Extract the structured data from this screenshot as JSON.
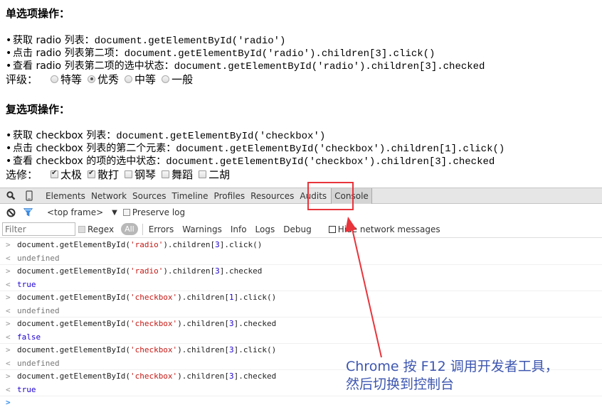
{
  "page": {
    "radio_section": {
      "title": "单选项操作：",
      "bullets": [
        {
          "label": "获取 radio 列表：",
          "code": "document.getElementById('radio')"
        },
        {
          "label": "点击 radio 列表第二项：",
          "code": "document.getElementById('radio').children[3].click()"
        },
        {
          "label": "查看 radio 列表第二项的选中状态：",
          "code": "document.getElementById('radio').children[3].checked"
        }
      ],
      "form_label": "评级：",
      "options": [
        {
          "label": "特等",
          "checked": false
        },
        {
          "label": "优秀",
          "checked": true
        },
        {
          "label": "中等",
          "checked": false
        },
        {
          "label": "一般",
          "checked": false
        }
      ]
    },
    "checkbox_section": {
      "title": "复选项操作：",
      "bullets": [
        {
          "label": "获取 checkbox 列表：",
          "code": "document.getElementById('checkbox')"
        },
        {
          "label": "点击 checkbox 列表的第二个元素：",
          "code": "document.getElementById('checkbox').children[1].click()"
        },
        {
          "label": "查看 checkbox 的项的选中状态：",
          "code": "document.getElementById('checkbox').children[3].checked"
        }
      ],
      "form_label": "选修：",
      "options": [
        {
          "label": "太极",
          "checked": true
        },
        {
          "label": "散打",
          "checked": true
        },
        {
          "label": "钢琴",
          "checked": false
        },
        {
          "label": "舞蹈",
          "checked": false
        },
        {
          "label": "二胡",
          "checked": false
        }
      ]
    }
  },
  "devtools": {
    "icons": {
      "inspect": "search-icon",
      "device": "mobile-device-icon",
      "clear": "clear-console-icon",
      "filter": "filter-icon"
    },
    "tabs": [
      "Elements",
      "Network",
      "Sources",
      "Timeline",
      "Profiles",
      "Resources",
      "Audits",
      "Console"
    ],
    "active_tab": "Console",
    "frame_select": "<top frame>",
    "preserve_log": {
      "label": "Preserve log",
      "checked": false
    },
    "filter": {
      "placeholder": "Filter",
      "value": ""
    },
    "regex": {
      "label": "Regex",
      "checked": false
    },
    "levels": [
      "All",
      "Errors",
      "Warnings",
      "Info",
      "Logs",
      "Debug"
    ],
    "active_level": "All",
    "hide_network": {
      "label": "Hide network messages",
      "checked": false
    },
    "console_entries": [
      {
        "input": "document.getElementById('radio').children[3].click()",
        "output": "undefined"
      },
      {
        "input": "document.getElementById('radio').children[3].checked",
        "output": "true"
      },
      {
        "input": "document.getElementById('checkbox').children[1].click()",
        "output": "undefined"
      },
      {
        "input": "document.getElementById('checkbox').children[3].checked",
        "output": "false"
      },
      {
        "input": "document.getElementById('checkbox').children[3].click()",
        "output": "undefined"
      },
      {
        "input": "document.getElementById('checkbox').children[3].checked",
        "output": "true"
      }
    ]
  },
  "annotation": {
    "line1": "Chrome 按 F12 调用开发者工具，",
    "line2": "然后切换到控制台",
    "color": "#e8343b",
    "text_color": "#3d56b0"
  }
}
